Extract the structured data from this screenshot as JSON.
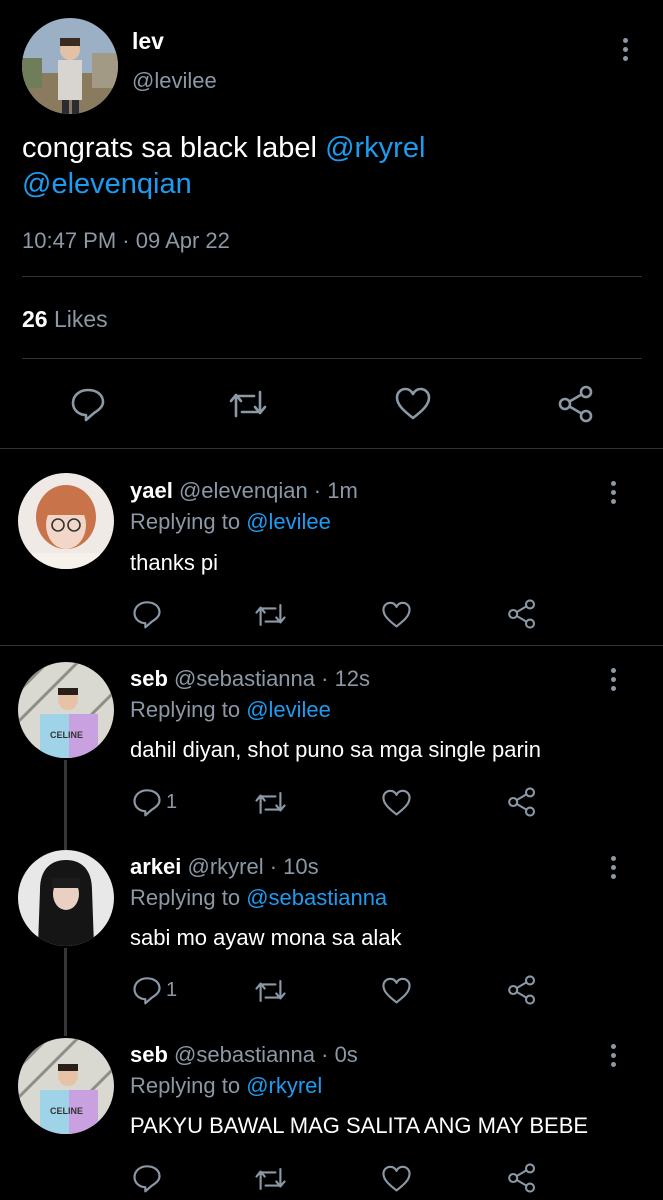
{
  "main_tweet": {
    "name": "lev",
    "handle": "@levilee",
    "text_plain": "congrats sa black label ",
    "mention1": "@rkyrel",
    "mention2": "@elevenqian",
    "timestamp": "10:47 PM · 09 Apr 22",
    "likes_count": "26",
    "likes_label": "Likes"
  },
  "replies": [
    {
      "name": "yael",
      "meta": " @elevenqian · 1m",
      "replying_label": "Replying to ",
      "replying_to": "@levilee",
      "text": "thanks pi",
      "reply_count": ""
    },
    {
      "name": "seb",
      "meta": " @sebastianna · 12s",
      "replying_label": "Replying to ",
      "replying_to": "@levilee",
      "text": "dahil diyan, shot puno sa mga single parin",
      "reply_count": "1"
    },
    {
      "name": "arkei",
      "meta": " @rkyrel · 10s",
      "replying_label": "Replying to ",
      "replying_to": "@sebastianna",
      "text": "sabi mo ayaw mona sa alak",
      "reply_count": "1"
    },
    {
      "name": "seb",
      "meta": " @sebastianna · 0s",
      "replying_label": "Replying to ",
      "replying_to": "@rkyrel",
      "text": "PAKYU BAWAL MAG SALITA ANG MAY BEBE",
      "reply_count": ""
    }
  ],
  "avatar_text": "CELINE",
  "colors": {
    "background": "#000000",
    "accent": "#1d9bf0",
    "muted": "#8b98a5",
    "divider": "#2f3336"
  },
  "icons": [
    "comment-icon",
    "retweet-icon",
    "like-icon",
    "share-icon",
    "more-icon"
  ]
}
